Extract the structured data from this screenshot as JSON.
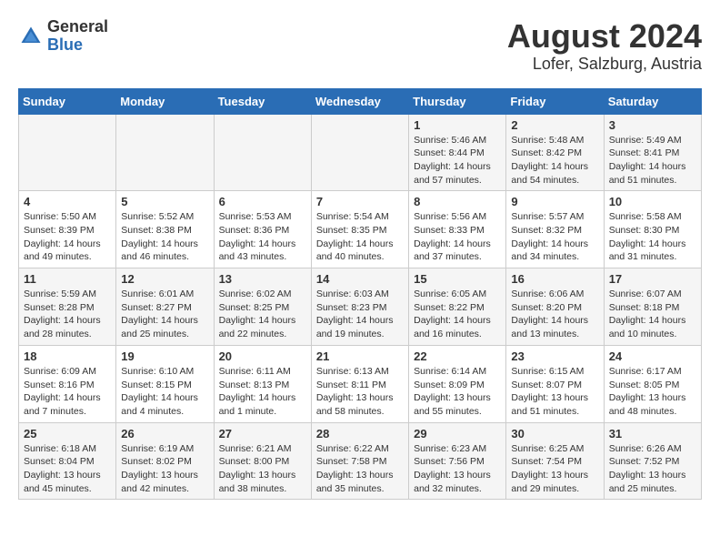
{
  "header": {
    "logo_general": "General",
    "logo_blue": "Blue",
    "title": "August 2024",
    "subtitle": "Lofer, Salzburg, Austria"
  },
  "calendar": {
    "days_of_week": [
      "Sunday",
      "Monday",
      "Tuesday",
      "Wednesday",
      "Thursday",
      "Friday",
      "Saturday"
    ],
    "weeks": [
      [
        {
          "day": "",
          "info": ""
        },
        {
          "day": "",
          "info": ""
        },
        {
          "day": "",
          "info": ""
        },
        {
          "day": "",
          "info": ""
        },
        {
          "day": "1",
          "info": "Sunrise: 5:46 AM\nSunset: 8:44 PM\nDaylight: 14 hours\nand 57 minutes."
        },
        {
          "day": "2",
          "info": "Sunrise: 5:48 AM\nSunset: 8:42 PM\nDaylight: 14 hours\nand 54 minutes."
        },
        {
          "day": "3",
          "info": "Sunrise: 5:49 AM\nSunset: 8:41 PM\nDaylight: 14 hours\nand 51 minutes."
        }
      ],
      [
        {
          "day": "4",
          "info": "Sunrise: 5:50 AM\nSunset: 8:39 PM\nDaylight: 14 hours\nand 49 minutes."
        },
        {
          "day": "5",
          "info": "Sunrise: 5:52 AM\nSunset: 8:38 PM\nDaylight: 14 hours\nand 46 minutes."
        },
        {
          "day": "6",
          "info": "Sunrise: 5:53 AM\nSunset: 8:36 PM\nDaylight: 14 hours\nand 43 minutes."
        },
        {
          "day": "7",
          "info": "Sunrise: 5:54 AM\nSunset: 8:35 PM\nDaylight: 14 hours\nand 40 minutes."
        },
        {
          "day": "8",
          "info": "Sunrise: 5:56 AM\nSunset: 8:33 PM\nDaylight: 14 hours\nand 37 minutes."
        },
        {
          "day": "9",
          "info": "Sunrise: 5:57 AM\nSunset: 8:32 PM\nDaylight: 14 hours\nand 34 minutes."
        },
        {
          "day": "10",
          "info": "Sunrise: 5:58 AM\nSunset: 8:30 PM\nDaylight: 14 hours\nand 31 minutes."
        }
      ],
      [
        {
          "day": "11",
          "info": "Sunrise: 5:59 AM\nSunset: 8:28 PM\nDaylight: 14 hours\nand 28 minutes."
        },
        {
          "day": "12",
          "info": "Sunrise: 6:01 AM\nSunset: 8:27 PM\nDaylight: 14 hours\nand 25 minutes."
        },
        {
          "day": "13",
          "info": "Sunrise: 6:02 AM\nSunset: 8:25 PM\nDaylight: 14 hours\nand 22 minutes."
        },
        {
          "day": "14",
          "info": "Sunrise: 6:03 AM\nSunset: 8:23 PM\nDaylight: 14 hours\nand 19 minutes."
        },
        {
          "day": "15",
          "info": "Sunrise: 6:05 AM\nSunset: 8:22 PM\nDaylight: 14 hours\nand 16 minutes."
        },
        {
          "day": "16",
          "info": "Sunrise: 6:06 AM\nSunset: 8:20 PM\nDaylight: 14 hours\nand 13 minutes."
        },
        {
          "day": "17",
          "info": "Sunrise: 6:07 AM\nSunset: 8:18 PM\nDaylight: 14 hours\nand 10 minutes."
        }
      ],
      [
        {
          "day": "18",
          "info": "Sunrise: 6:09 AM\nSunset: 8:16 PM\nDaylight: 14 hours\nand 7 minutes."
        },
        {
          "day": "19",
          "info": "Sunrise: 6:10 AM\nSunset: 8:15 PM\nDaylight: 14 hours\nand 4 minutes."
        },
        {
          "day": "20",
          "info": "Sunrise: 6:11 AM\nSunset: 8:13 PM\nDaylight: 14 hours\nand 1 minute."
        },
        {
          "day": "21",
          "info": "Sunrise: 6:13 AM\nSunset: 8:11 PM\nDaylight: 13 hours\nand 58 minutes."
        },
        {
          "day": "22",
          "info": "Sunrise: 6:14 AM\nSunset: 8:09 PM\nDaylight: 13 hours\nand 55 minutes."
        },
        {
          "day": "23",
          "info": "Sunrise: 6:15 AM\nSunset: 8:07 PM\nDaylight: 13 hours\nand 51 minutes."
        },
        {
          "day": "24",
          "info": "Sunrise: 6:17 AM\nSunset: 8:05 PM\nDaylight: 13 hours\nand 48 minutes."
        }
      ],
      [
        {
          "day": "25",
          "info": "Sunrise: 6:18 AM\nSunset: 8:04 PM\nDaylight: 13 hours\nand 45 minutes."
        },
        {
          "day": "26",
          "info": "Sunrise: 6:19 AM\nSunset: 8:02 PM\nDaylight: 13 hours\nand 42 minutes."
        },
        {
          "day": "27",
          "info": "Sunrise: 6:21 AM\nSunset: 8:00 PM\nDaylight: 13 hours\nand 38 minutes."
        },
        {
          "day": "28",
          "info": "Sunrise: 6:22 AM\nSunset: 7:58 PM\nDaylight: 13 hours\nand 35 minutes."
        },
        {
          "day": "29",
          "info": "Sunrise: 6:23 AM\nSunset: 7:56 PM\nDaylight: 13 hours\nand 32 minutes."
        },
        {
          "day": "30",
          "info": "Sunrise: 6:25 AM\nSunset: 7:54 PM\nDaylight: 13 hours\nand 29 minutes."
        },
        {
          "day": "31",
          "info": "Sunrise: 6:26 AM\nSunset: 7:52 PM\nDaylight: 13 hours\nand 25 minutes."
        }
      ]
    ]
  }
}
